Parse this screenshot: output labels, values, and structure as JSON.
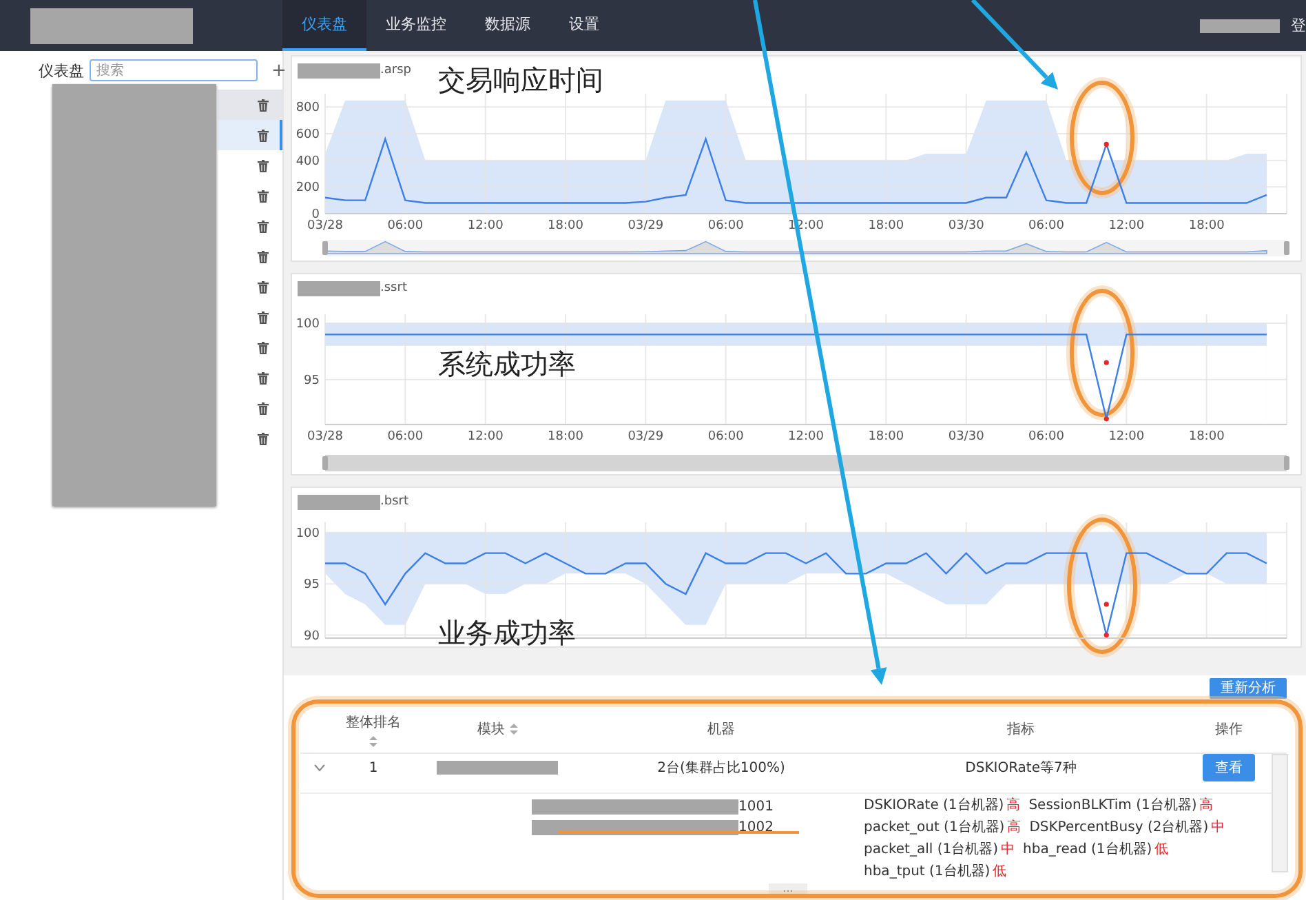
{
  "nav": {
    "tabs": [
      {
        "label": "仪表盘",
        "selected": true
      },
      {
        "label": "业务监控",
        "selected": false
      },
      {
        "label": "数据源",
        "selected": false
      },
      {
        "label": "设置",
        "selected": false
      }
    ],
    "user_action": "登"
  },
  "sidebar": {
    "title": "仪表盘",
    "search": {
      "placeholder": "搜索"
    },
    "add": "+",
    "items": [
      {
        "selected": false,
        "hovered": true
      },
      {
        "selected": true,
        "hovered": false
      },
      {
        "selected": false,
        "hovered": false
      },
      {
        "selected": false,
        "hovered": false
      },
      {
        "selected": false,
        "hovered": false
      },
      {
        "selected": false,
        "hovered": false
      },
      {
        "selected": false,
        "hovered": false
      },
      {
        "selected": false,
        "hovered": false
      },
      {
        "selected": false,
        "hovered": false
      },
      {
        "selected": false,
        "hovered": false
      },
      {
        "selected": false,
        "hovered": false
      },
      {
        "selected": false,
        "hovered": false
      }
    ]
  },
  "charts": [
    {
      "title": ".arsp",
      "caption": "交易响应时间",
      "slider": true,
      "slider_preview": true,
      "chart_data": {
        "type": "line",
        "grid": true,
        "ylim": [
          0,
          900
        ],
        "yticks": [
          0,
          200,
          400,
          600,
          800
        ],
        "categories": [
          "03/28",
          null,
          null,
          null,
          "06:00",
          null,
          null,
          null,
          "12:00",
          null,
          null,
          null,
          "18:00",
          null,
          null,
          null,
          "03/29",
          null,
          null,
          null,
          "06:00",
          null,
          null,
          null,
          "12:00",
          null,
          null,
          null,
          "18:00",
          null,
          null,
          null,
          "03/30",
          null,
          null,
          null,
          "06:00",
          null,
          null,
          null,
          "12:00",
          null,
          null,
          null,
          "18:00",
          null,
          null,
          null
        ],
        "series": [
          {
            "type": "area",
            "color": "#d9e5f8",
            "values": [
              450,
              850,
              850,
              850,
              850,
              400,
              400,
              400,
              400,
              400,
              400,
              400,
              400,
              400,
              400,
              400,
              400,
              850,
              850,
              850,
              850,
              400,
              400,
              null,
              400,
              400,
              400,
              400,
              400,
              400,
              450,
              450,
              450,
              850,
              850,
              850,
              850,
              400,
              null,
              null,
              null,
              400,
              400,
              400,
              400,
              400,
              450,
              450
            ]
          },
          {
            "type": "line",
            "color": "#3a7ee8",
            "values": [
              120,
              100,
              100,
              560,
              100,
              80,
              80,
              80,
              80,
              80,
              80,
              80,
              80,
              80,
              80,
              80,
              90,
              120,
              140,
              560,
              100,
              80,
              80,
              80,
              80,
              80,
              80,
              80,
              80,
              80,
              80,
              80,
              80,
              120,
              120,
              460,
              100,
              80,
              80,
              520,
              80,
              80,
              80,
              80,
              80,
              80,
              80,
              140
            ]
          },
          {
            "type": "scatter",
            "color": "#e8262b",
            "values": [
              null,
              null,
              null,
              null,
              null,
              null,
              null,
              null,
              null,
              null,
              null,
              null,
              null,
              null,
              null,
              null,
              null,
              null,
              null,
              null,
              null,
              null,
              null,
              null,
              null,
              null,
              null,
              null,
              null,
              null,
              null,
              null,
              null,
              null,
              null,
              null,
              null,
              null,
              null,
              520,
              null,
              null,
              null,
              null,
              null,
              null,
              null,
              null
            ]
          }
        ]
      }
    },
    {
      "title": ".ssrt",
      "caption": "系统成功率",
      "slider": true,
      "slider_preview": false,
      "chart_data": {
        "type": "line",
        "grid": true,
        "ylim": [
          91,
          100.8
        ],
        "yticks": [
          95,
          100
        ],
        "categories": [
          "03/28",
          null,
          null,
          null,
          "06:00",
          null,
          null,
          null,
          "12:00",
          null,
          null,
          null,
          "18:00",
          null,
          null,
          null,
          "03/29",
          null,
          null,
          null,
          "06:00",
          null,
          null,
          null,
          "12:00",
          null,
          null,
          null,
          "18:00",
          null,
          null,
          null,
          "03/30",
          null,
          null,
          null,
          "06:00",
          null,
          null,
          null,
          "12:00",
          null,
          null,
          null,
          "18:00",
          null,
          null,
          null
        ],
        "series": [
          {
            "type": "area",
            "color": "#d9e5f8",
            "values": [
              100,
              100,
              100,
              100,
              100,
              100,
              100,
              100,
              100,
              100,
              100,
              100,
              100,
              100,
              100,
              100,
              100,
              100,
              100,
              100,
              100,
              100,
              100,
              100,
              100,
              100,
              100,
              100,
              100,
              100,
              100,
              100,
              100,
              100,
              100,
              100,
              100,
              100,
              null,
              null,
              null,
              100,
              100,
              100,
              100,
              100,
              100,
              100
            ]
          },
          {
            "type": "area",
            "color": "#ffffff",
            "values": [
              98,
              98,
              98,
              98,
              98,
              98,
              98,
              98,
              98,
              98,
              98,
              98,
              98,
              98,
              98,
              98,
              98,
              98,
              98,
              98,
              98,
              98,
              98,
              98,
              98,
              98,
              98,
              98,
              98,
              98,
              98,
              98,
              98,
              98,
              98,
              98,
              98,
              98,
              null,
              null,
              null,
              98,
              98,
              98,
              98,
              98,
              98,
              98
            ]
          },
          {
            "type": "line",
            "color": "#3a7ee8",
            "values": [
              99,
              99,
              99,
              99,
              99,
              99,
              99,
              99,
              99,
              99,
              99,
              99,
              99,
              99,
              99,
              99,
              99,
              99,
              99,
              99,
              99,
              99,
              99,
              99,
              99,
              99,
              99,
              99,
              99,
              99,
              99,
              99,
              99,
              99,
              99,
              99,
              99,
              99,
              99,
              91.5,
              99,
              99,
              99,
              99,
              99,
              99,
              99,
              99
            ]
          },
          {
            "type": "scatter",
            "color": "#e8262b",
            "values": [
              null,
              null,
              null,
              null,
              null,
              null,
              null,
              null,
              null,
              null,
              null,
              null,
              null,
              null,
              null,
              null,
              null,
              null,
              null,
              null,
              null,
              null,
              null,
              null,
              null,
              null,
              null,
              null,
              null,
              null,
              null,
              null,
              null,
              null,
              null,
              null,
              null,
              null,
              null,
              91.5,
              null,
              null,
              null,
              null,
              null,
              null,
              null,
              null
            ]
          },
          {
            "type": "scatter",
            "color": "#e8262b",
            "values": [
              null,
              null,
              null,
              null,
              null,
              null,
              null,
              null,
              null,
              null,
              null,
              null,
              null,
              null,
              null,
              null,
              null,
              null,
              null,
              null,
              null,
              null,
              null,
              null,
              null,
              null,
              null,
              null,
              null,
              null,
              null,
              null,
              null,
              null,
              null,
              null,
              null,
              null,
              null,
              96.5,
              null,
              null,
              null,
              null,
              null,
              null,
              null,
              null
            ]
          }
        ]
      }
    },
    {
      "title": ".bsrt",
      "caption": "业务成功率",
      "chart_data": {
        "type": "line",
        "grid": true,
        "ylim": [
          89.7,
          101
        ],
        "yticks": [
          90,
          95,
          100
        ],
        "categories": [
          null,
          null,
          null,
          null,
          null,
          null,
          null,
          null,
          null,
          null,
          null,
          null,
          null,
          null,
          null,
          null,
          null,
          null,
          null,
          null,
          null,
          null,
          null,
          null,
          null,
          null,
          null,
          null,
          null,
          null,
          null,
          null,
          null,
          null,
          null,
          null,
          null,
          null,
          null,
          null,
          null,
          null,
          null,
          null,
          null,
          null,
          null,
          null
        ],
        "series": [
          {
            "type": "area",
            "color": "#d9e5f8",
            "values": [
              100,
              100,
              100,
              100,
              100,
              100,
              100,
              100,
              100,
              100,
              100,
              100,
              100,
              100,
              100,
              100,
              100,
              100,
              100,
              100,
              100,
              100,
              100,
              100,
              100,
              100,
              100,
              100,
              100,
              100,
              100,
              100,
              100,
              100,
              100,
              100,
              100,
              100,
              null,
              null,
              null,
              100,
              100,
              100,
              100,
              100,
              100,
              100
            ]
          },
          {
            "type": "area",
            "color": "#ffffff",
            "values": [
              96,
              94,
              93,
              91,
              91,
              95,
              95,
              95,
              94,
              94,
              95,
              95,
              96,
              96,
              96,
              96,
              95,
              93,
              91,
              91,
              95,
              95,
              95,
              95,
              96,
              96,
              96,
              96,
              96,
              95,
              94,
              93,
              93,
              93,
              95,
              95,
              95,
              null,
              null,
              null,
              null,
              95,
              95,
              96,
              96,
              95,
              95,
              95
            ]
          },
          {
            "type": "line",
            "color": "#3a7ee8",
            "values": [
              97,
              97,
              96,
              93,
              96,
              98,
              97,
              97,
              98,
              98,
              97,
              98,
              97,
              96,
              96,
              97,
              97,
              95,
              94,
              98,
              97,
              97,
              98,
              98,
              97,
              98,
              96,
              96,
              97,
              97,
              98,
              96,
              98,
              96,
              97,
              97,
              98,
              98,
              98,
              90,
              98,
              98,
              97,
              96,
              96,
              98,
              98,
              97
            ]
          },
          {
            "type": "scatter",
            "color": "#e8262b",
            "values": [
              null,
              null,
              null,
              null,
              null,
              null,
              null,
              null,
              null,
              null,
              null,
              null,
              null,
              null,
              null,
              null,
              null,
              null,
              null,
              null,
              null,
              null,
              null,
              null,
              null,
              null,
              null,
              null,
              null,
              null,
              null,
              null,
              null,
              null,
              null,
              null,
              null,
              null,
              null,
              90,
              null,
              null,
              null,
              null,
              null,
              null,
              null,
              null
            ]
          },
          {
            "type": "scatter",
            "color": "#e8262b",
            "values": [
              null,
              null,
              null,
              null,
              null,
              null,
              null,
              null,
              null,
              null,
              null,
              null,
              null,
              null,
              null,
              null,
              null,
              null,
              null,
              null,
              null,
              null,
              null,
              null,
              null,
              null,
              null,
              null,
              null,
              null,
              null,
              null,
              null,
              null,
              null,
              null,
              null,
              null,
              null,
              93,
              null,
              null,
              null,
              null,
              null,
              null,
              null,
              null
            ]
          }
        ]
      }
    }
  ],
  "analysis": {
    "reanalyze": "重新分析",
    "columns": [
      {
        "label": "整体排名",
        "sortable": true
      },
      {
        "label": "模块",
        "sortable": true
      },
      {
        "label": "机器",
        "sortable": false
      },
      {
        "label": "指标",
        "sortable": false
      },
      {
        "label": "操作",
        "sortable": false
      }
    ],
    "rows": [
      {
        "expanded": true,
        "rank": "1",
        "machines": "2台(集群占比100%)",
        "indicators": "DSKIORate等7种",
        "action": "查看",
        "details": {
          "machines": [
            "1001",
            "1002"
          ],
          "indicator_lines": [
            [
              {
                "name": "DSKIORate (1台机器)",
                "severity": "高"
              },
              {
                "name": "SessionBLKTim (1台机器)",
                "severity": "高"
              }
            ],
            [
              {
                "name": "packet_out (1台机器)",
                "severity": "高"
              },
              {
                "name": "DSKPercentBusy (2台机器)",
                "severity": "中"
              }
            ],
            [
              {
                "name": "packet_all (1台机器)",
                "severity": "中"
              },
              {
                "name": "hba_read (1台机器)",
                "severity": "低"
              }
            ],
            [
              {
                "name": "hba_tput (1台机器)",
                "severity": "低"
              }
            ]
          ]
        }
      }
    ],
    "more": "..."
  }
}
